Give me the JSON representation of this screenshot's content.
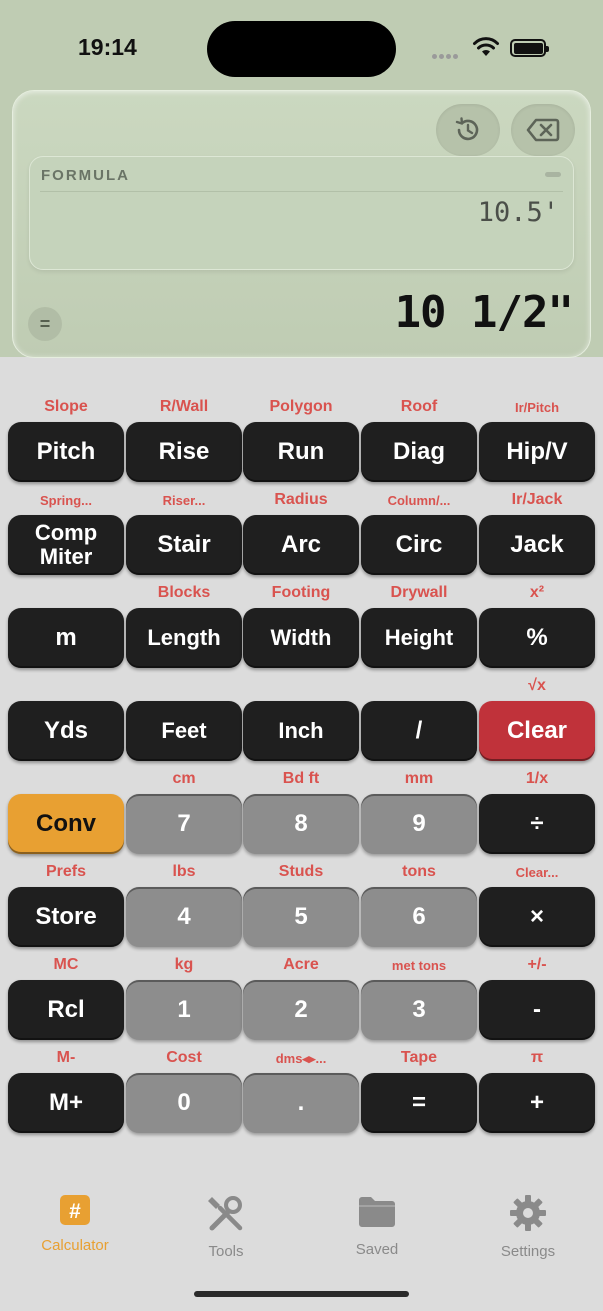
{
  "status": {
    "time": "19:14"
  },
  "display": {
    "formula_label": "FORMULA",
    "formula_value": "10.5'",
    "equals_symbol": "=",
    "result": "10 1/2\""
  },
  "keys": [
    {
      "sub": "Slope",
      "label": "Pitch"
    },
    {
      "sub": "R/Wall",
      "label": "Rise"
    },
    {
      "sub": "Polygon",
      "label": "Run"
    },
    {
      "sub": "Roof",
      "label": "Diag"
    },
    {
      "sub": "Ir/Pitch",
      "label": "Hip/V"
    },
    {
      "sub": "Spring...",
      "label": "Comp Miter"
    },
    {
      "sub": "Riser...",
      "label": "Stair"
    },
    {
      "sub": "Radius",
      "label": "Arc"
    },
    {
      "sub": "Column/...",
      "label": "Circ"
    },
    {
      "sub": "Ir/Jack",
      "label": "Jack"
    },
    {
      "sub": "",
      "label": "m"
    },
    {
      "sub": "Blocks",
      "label": "Length"
    },
    {
      "sub": "Footing",
      "label": "Width"
    },
    {
      "sub": "Drywall",
      "label": "Height"
    },
    {
      "sub": "x²",
      "label": "%"
    },
    {
      "sub": "",
      "label": "Yds"
    },
    {
      "sub": "",
      "label": "Feet"
    },
    {
      "sub": "",
      "label": "Inch"
    },
    {
      "sub": "",
      "label": "/"
    },
    {
      "sub": "√x",
      "label": "Clear"
    },
    {
      "sub": "",
      "label": "Conv"
    },
    {
      "sub": "cm",
      "label": "7"
    },
    {
      "sub": "Bd ft",
      "label": "8"
    },
    {
      "sub": "mm",
      "label": "9"
    },
    {
      "sub": "1/x",
      "label": "÷"
    },
    {
      "sub": "Prefs",
      "label": "Store"
    },
    {
      "sub": "lbs",
      "label": "4"
    },
    {
      "sub": "Studs",
      "label": "5"
    },
    {
      "sub": "tons",
      "label": "6"
    },
    {
      "sub": "Clear...",
      "label": "×"
    },
    {
      "sub": "MC",
      "label": "Rcl"
    },
    {
      "sub": "kg",
      "label": "1"
    },
    {
      "sub": "Acre",
      "label": "2"
    },
    {
      "sub": "met tons",
      "label": "3"
    },
    {
      "sub": "+/-",
      "label": "-"
    },
    {
      "sub": "M-",
      "label": "M+"
    },
    {
      "sub": "Cost",
      "label": "0"
    },
    {
      "sub": "dms◂▸...",
      "label": "."
    },
    {
      "sub": "Tape",
      "label": "="
    },
    {
      "sub": "π",
      "label": "+"
    }
  ],
  "tabs": [
    {
      "label": "Calculator",
      "icon": "calculator-icon"
    },
    {
      "label": "Tools",
      "icon": "tools-icon"
    },
    {
      "label": "Saved",
      "icon": "folder-icon"
    },
    {
      "label": "Settings",
      "icon": "gear-icon"
    }
  ],
  "colors": {
    "display_bg": "#bfccb3",
    "accent_red_label": "#d9534f",
    "clear_key": "#c0323a",
    "conv_key": "#e8a032",
    "dark_key": "#1f1f1f",
    "number_key": "#8d8d8d",
    "active_tab": "#e8a032"
  }
}
